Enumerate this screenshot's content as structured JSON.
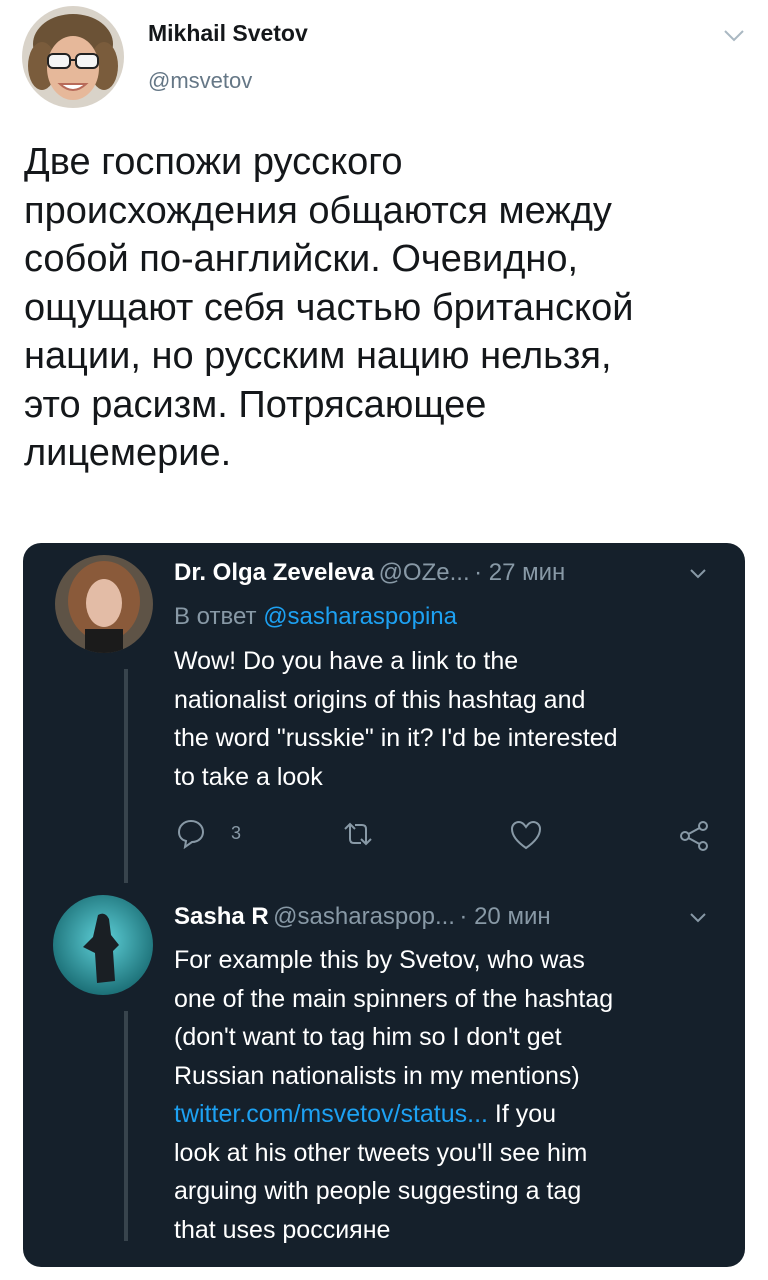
{
  "tweet": {
    "author_name": "Mikhail Svetov",
    "author_handle": "@msvetov",
    "text": "Две госпожи русского\nпроисхождения общаются между\nсобой по-английски. Очевидно,\nощущают себя частью британской\nнации, но русским нацию нельзя,\nэто расизм. Потрясающее\nлицемерие."
  },
  "quoted": {
    "reply1": {
      "name": "Dr. Olga Zeveleva",
      "handle": "@OZe...",
      "time": "· 27 мин",
      "reply_prefix": "В ответ",
      "reply_to": "@sasharaspopina",
      "text": "Wow! Do you have a link to the\nnationalist origins of this hashtag and\nthe word \"russkie\" in it? I'd be interested\nto take a look",
      "reply_count": "3"
    },
    "reply2": {
      "name": "Sasha R",
      "handle": "@sasharaspop...",
      "time": "· 20 мин",
      "text_before": "For example this by Svetov, who was\none of the main spinners of the hashtag\n(don't want to tag him so I don't get\nRussian nationalists in my mentions)\n",
      "link": "twitter.com/msvetov/status...",
      "text_after": " If you\nlook at his other tweets you'll see him\narguing with people suggesting a tag\nthat uses россияне"
    }
  },
  "colors": {
    "card_bg": "#15202b",
    "link": "#1da1f2",
    "muted": "#8899a6"
  },
  "icons": [
    "chevron-down-icon",
    "reply-icon",
    "retweet-icon",
    "like-icon",
    "share-icon"
  ]
}
